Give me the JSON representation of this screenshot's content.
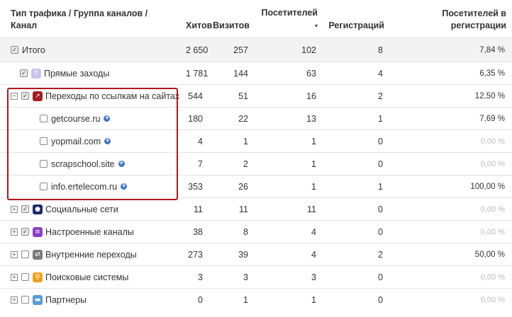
{
  "header": {
    "col_source_line1": "Тип трафика / Группа каналов /",
    "col_source_line2": "Канал",
    "col_hits": "Хитов",
    "col_visits": "Визитов",
    "col_visitors_line1": "Посетителей",
    "col_visitors_sort": "▾",
    "col_registrations": "Регистраций",
    "col_rate_line1": "Посетителей в",
    "col_rate_line2": "регистрации"
  },
  "rows": [
    {
      "label": "Итого",
      "hits": "2 650",
      "visits": "257",
      "visitors": "102",
      "regs": "8",
      "rate": "7,84 %"
    },
    {
      "label": "Прямые заходы",
      "hits": "1 781",
      "visits": "144",
      "visitors": "63",
      "regs": "4",
      "rate": "6,35 %",
      "icon": "arrow-up-icon",
      "color": "#c8c4ee"
    },
    {
      "label": "Переходы по ссылкам на сайтах",
      "hits": "544",
      "visits": "51",
      "visitors": "16",
      "regs": "2",
      "rate": "12,50 %",
      "icon": "external-link-icon",
      "color": "#a31d22"
    },
    {
      "label": "getcourse.ru",
      "hits": "180",
      "visits": "22",
      "visitors": "13",
      "regs": "1",
      "rate": "7,69 %"
    },
    {
      "label": "yopmail.com",
      "hits": "4",
      "visits": "1",
      "visitors": "1",
      "regs": "0",
      "rate": "0,00 %"
    },
    {
      "label": "scrapschool.site",
      "hits": "7",
      "visits": "2",
      "visitors": "1",
      "regs": "0",
      "rate": "0,00 %"
    },
    {
      "label": "info.ertelecom.ru",
      "hits": "353",
      "visits": "26",
      "visitors": "1",
      "regs": "1",
      "rate": "100,00 %"
    },
    {
      "label": "Социальные сети",
      "hits": "11",
      "visits": "11",
      "visitors": "11",
      "regs": "0",
      "rate": "0,00 %",
      "icon": "person-icon",
      "color": "#1d2a6e"
    },
    {
      "label": "Настроенные каналы",
      "hits": "38",
      "visits": "8",
      "visitors": "4",
      "regs": "0",
      "rate": "0,00 %",
      "icon": "list-icon",
      "color": "#8a3fc7"
    },
    {
      "label": "Внутренние переходы",
      "hits": "273",
      "visits": "39",
      "visitors": "4",
      "regs": "2",
      "rate": "50,00 %",
      "icon": "swap-icon",
      "color": "#7a7a7a"
    },
    {
      "label": "Поисковые системы",
      "hits": "3",
      "visits": "3",
      "visitors": "3",
      "regs": "0",
      "rate": "0,00 %",
      "icon": "search-icon",
      "color": "#f0a020"
    },
    {
      "label": "Партнеры",
      "hits": "0",
      "visits": "1",
      "visitors": "1",
      "regs": "0",
      "rate": "0,00 %",
      "icon": "chat-icon",
      "color": "#5b9bd8"
    }
  ]
}
